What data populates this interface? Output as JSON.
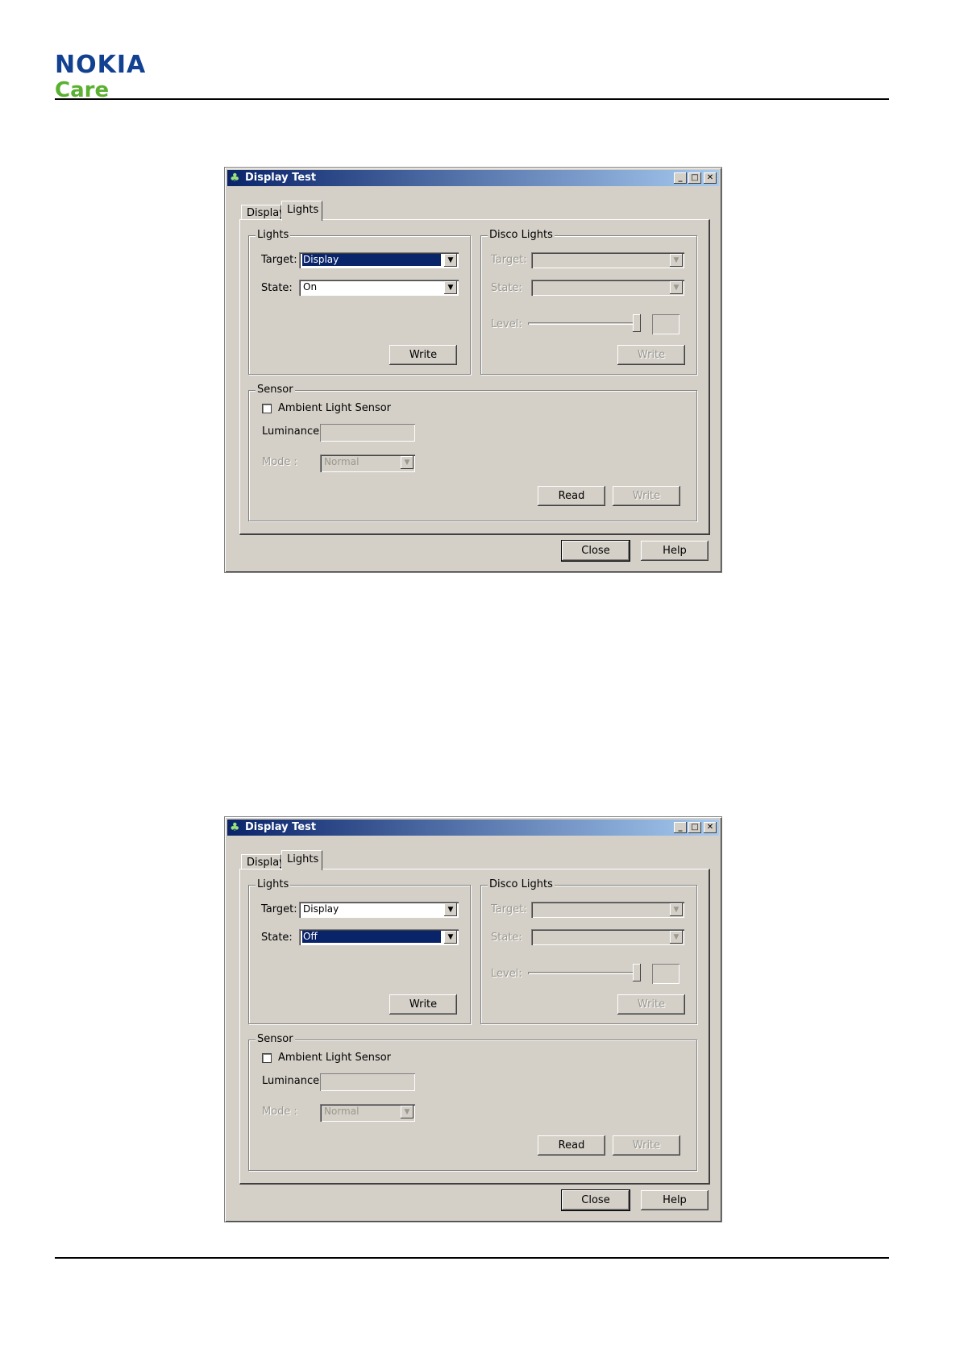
{
  "brand": {
    "name": "NOKIA",
    "sub": "Care"
  },
  "dialogs": [
    {
      "title": "Display Test",
      "tabs": [
        "Display",
        "Lights"
      ],
      "lights": {
        "group_label": "Lights",
        "target_label": "Target:",
        "target_value": "Display",
        "state_label": "State:",
        "state_value": "On",
        "write_label": "Write"
      },
      "disco": {
        "group_label": "Disco Lights",
        "target_label": "Target:",
        "state_label": "State:",
        "level_label": "Level:",
        "write_label": "Write"
      },
      "sensor": {
        "group_label": "Sensor",
        "checkbox_label": "Ambient Light Sensor",
        "luminance_label": "Luminance :",
        "mode_label": "Mode :",
        "mode_value": "Normal",
        "read_label": "Read",
        "write_label": "Write"
      },
      "close_label": "Close",
      "help_label": "Help"
    },
    {
      "title": "Display Test",
      "tabs": [
        "Display",
        "Lights"
      ],
      "lights": {
        "group_label": "Lights",
        "target_label": "Target:",
        "target_value": "Display",
        "state_label": "State:",
        "state_value": "Off",
        "write_label": "Write"
      },
      "disco": {
        "group_label": "Disco Lights",
        "target_label": "Target:",
        "state_label": "State:",
        "level_label": "Level:",
        "write_label": "Write"
      },
      "sensor": {
        "group_label": "Sensor",
        "checkbox_label": "Ambient Light Sensor",
        "luminance_label": "Luminance :",
        "mode_label": "Mode :",
        "mode_value": "Normal",
        "read_label": "Read",
        "write_label": "Write"
      },
      "close_label": "Close",
      "help_label": "Help"
    }
  ]
}
